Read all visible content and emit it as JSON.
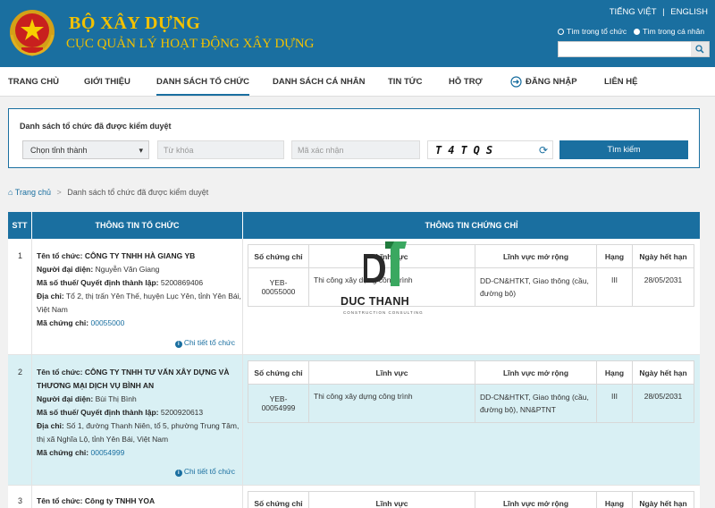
{
  "header": {
    "title": "BỘ XÂY DỰNG",
    "subtitle": "CỤC QUẢN LÝ HOẠT ĐỘNG XÂY DỰNG",
    "lang_vi": "TIẾNG VIỆT",
    "lang_sep": "|",
    "lang_en": "ENGLISH",
    "radio_org": "Tìm trong tổ chức",
    "radio_person": "Tìm trong cá nhân",
    "search_value": ""
  },
  "nav": [
    {
      "label": "TRANG CHỦ"
    },
    {
      "label": "GIỚI THIỆU"
    },
    {
      "label": "DANH SÁCH TỔ CHỨC"
    },
    {
      "label": "DANH SÁCH CÁ NHÂN"
    },
    {
      "label": "TIN TỨC"
    },
    {
      "label": "HỖ TRỢ"
    },
    {
      "label": "ĐĂNG NHẬP"
    },
    {
      "label": "LIÊN HỆ"
    }
  ],
  "filter": {
    "title": "Danh sách tổ chức đã được kiểm duyệt",
    "province_value": "Chọn tỉnh thành",
    "keyword_placeholder": "Từ khóa",
    "captcha_placeholder": "Mã xác nhận",
    "captcha_text": "T4TQS",
    "search_label": "Tìm kiếm"
  },
  "breadcrumb": {
    "home": "Trang chủ",
    "sep": ">",
    "current": "Danh sách tổ chức đã được kiểm duyệt"
  },
  "table": {
    "col_stt": "STT",
    "col_org": "THÔNG TIN TỔ CHỨC",
    "col_cert": "THÔNG TIN CHỨNG CHỈ",
    "cert_headers": {
      "number": "Số chứng chỉ",
      "field": "Lĩnh vực",
      "extended": "Lĩnh vực mở rộng",
      "rank": "Hạng",
      "expiry": "Ngày hết hạn"
    },
    "detail_label": "Chi tiết tổ chức",
    "labels": {
      "name": "Tên tổ chức:",
      "rep": "Người đại diện:",
      "tax": "Mã số thuế/ Quyết định thành lập:",
      "address": "Địa chỉ:",
      "cert_code": "Mã chứng chỉ:"
    },
    "rows": [
      {
        "stt": "1",
        "name": "CÔNG TY TNHH HÀ GIANG YB",
        "rep": "Nguyễn Văn Giang",
        "tax": "5200869406",
        "address": "Tổ 2, thị trấn Yên Thế, huyện Lục Yên, tỉnh Yên Bái, Việt Nam",
        "cert_code": "00055000",
        "cert": {
          "number": "YEB-00055000",
          "field": "Thi công xây dựng công trình",
          "extended": "DD-CN&HTKT, Giao thông (cầu, đường bộ)",
          "rank": "III",
          "expiry": "28/05/2031"
        }
      },
      {
        "stt": "2",
        "name": "CÔNG TY TNHH TƯ VẤN XÂY DỰNG VÀ THƯƠNG MẠI DỊCH VỤ BÌNH AN",
        "rep": "Bùi Thị Bình",
        "tax": "5200920613",
        "address": "Số 1, đường Thanh Niên, tổ 5, phường Trung Tâm, thị xã Nghĩa Lộ, tỉnh Yên Bái, Việt Nam",
        "cert_code": "00054999",
        "cert": {
          "number": "YEB-00054999",
          "field": "Thi công xây dựng công trình",
          "extended": "DD-CN&HTKT, Giao thông (cầu, đường bộ), NN&PTNT",
          "rank": "III",
          "expiry": "28/05/2031"
        }
      },
      {
        "stt": "3",
        "name": "Công ty TNHH YOA"
      }
    ]
  },
  "watermark": {
    "text": "DUC THANH",
    "sub": "CONSTRUCTION CONSULTING"
  },
  "colors": {
    "primary": "#1a6fa0",
    "gold": "#f2c100",
    "alt_row": "#d9f0f4"
  }
}
